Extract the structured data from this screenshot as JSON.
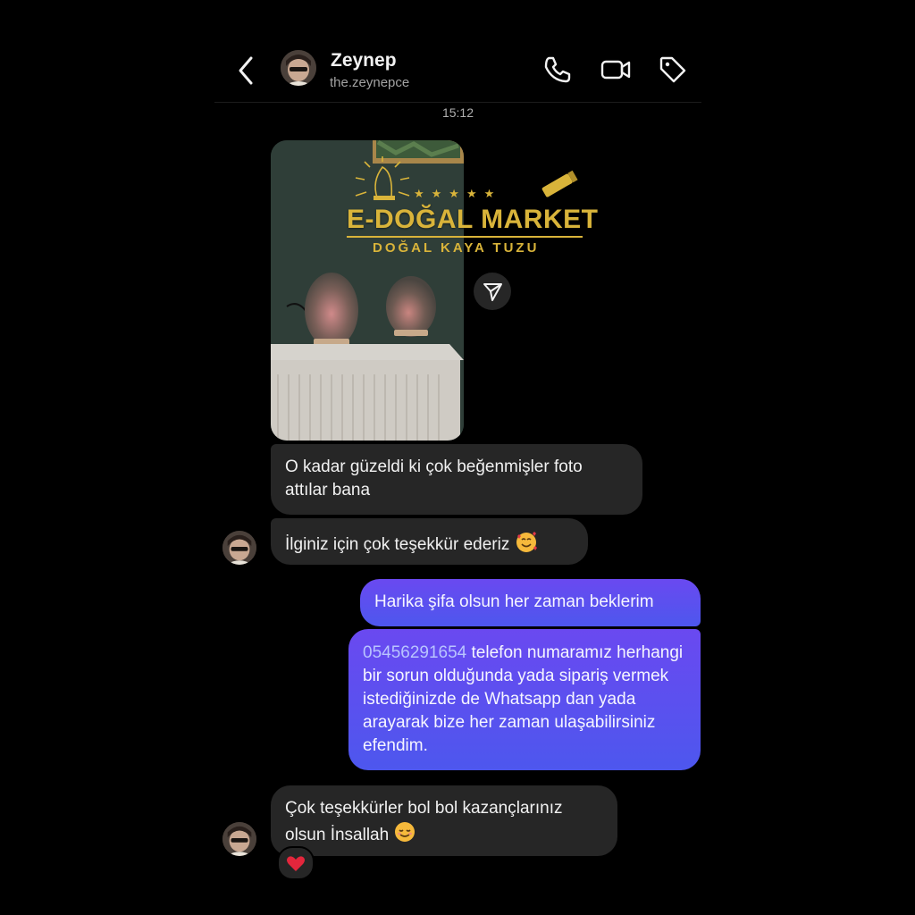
{
  "header": {
    "contact_name": "Zeynep",
    "contact_handle": "the.zeynepce",
    "icons": [
      "chevron-left-icon",
      "phone-icon",
      "video-icon",
      "tag-icon"
    ]
  },
  "timestamp": "15:12",
  "photo_message": {
    "watermark": {
      "title": "E-DOĞAL MARKET",
      "subtitle": "DOĞAL KAYA TUZU",
      "stars": "★★★★★"
    }
  },
  "messages": [
    {
      "direction": "incoming",
      "text": "O kadar güzeldi ki çok beğenmişler foto attılar bana"
    },
    {
      "direction": "incoming",
      "text": "İlginiz için çok teşekkür ederiz",
      "emoji": "smiling-face-with-hearts"
    },
    {
      "direction": "outgoing",
      "text": "Harika şifa olsun her zaman beklerim"
    },
    {
      "direction": "outgoing",
      "phone": "05456291654",
      "text": " telefon numaramız herhangi bir sorun olduğunda yada sipariş vermek istediğinizde de Whatsapp dan yada arayarak bize her zaman ulaşabilirsiniz efendim."
    },
    {
      "direction": "incoming",
      "text": "Çok teşekkürler bol bol kazançlarınız olsun İnsallah",
      "emoji": "smiling-face",
      "reaction": "red-heart"
    }
  ],
  "colors": {
    "background": "#000000",
    "incoming_bubble": "#262626",
    "outgoing_bubble_top": "#6a49f0",
    "outgoing_bubble_bottom": "#4d57ee",
    "watermark_gold": "#d9b43a"
  }
}
